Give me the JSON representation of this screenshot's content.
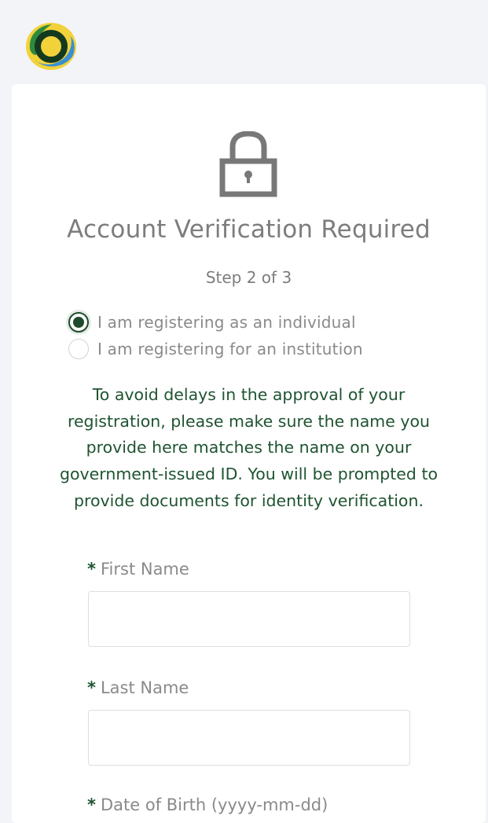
{
  "brand": {
    "logo_icon": "paxos-ring-logo-icon"
  },
  "header": {
    "icon": "lock-icon",
    "title": "Account Verification Required",
    "step": "Step 2 of 3"
  },
  "registration_type": {
    "options": [
      {
        "label": "I am registering as an individual",
        "selected": true
      },
      {
        "label": "I am registering for an institution",
        "selected": false
      }
    ]
  },
  "notice": "To avoid delays in the approval of your registration, please make sure the name you provide here matches the name on your government-issued ID. You will be prompted to provide documents for identity verification.",
  "form": {
    "required_mark": "*",
    "first_name": {
      "label": "First Name",
      "value": ""
    },
    "last_name": {
      "label": "Last Name",
      "value": ""
    },
    "dob": {
      "label": "Date of Birth (yyyy-mm-dd)"
    }
  },
  "colors": {
    "accent": "#1e4a2c",
    "notice_text": "#1f5431",
    "muted_text": "#7d7d7d",
    "page_bg": "#f3f4f7"
  }
}
